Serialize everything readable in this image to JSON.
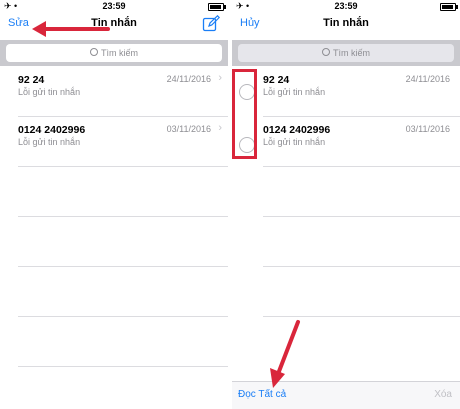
{
  "status_bar": {
    "time": "23:59",
    "left_icons": "✈ •"
  },
  "left_screen": {
    "nav": {
      "edit_label": "Sửa",
      "title": "Tin nhắn"
    },
    "search": {
      "placeholder": "Tìm kiếm"
    },
    "conversations": [
      {
        "name": "92 24",
        "date": "24/11/2016",
        "subtitle": "Lỗi gửi tin nhắn"
      },
      {
        "name": "0124 2402996",
        "date": "03/11/2016",
        "subtitle": "Lỗi gửi tin nhắn"
      }
    ]
  },
  "right_screen": {
    "nav": {
      "cancel_label": "Hủy",
      "title": "Tin nhắn"
    },
    "search": {
      "placeholder": "Tìm kiếm"
    },
    "conversations": [
      {
        "name": "92 24",
        "date": "24/11/2016",
        "subtitle": "Lỗi gửi tin nhắn"
      },
      {
        "name": "0124 2402996",
        "date": "03/11/2016",
        "subtitle": "Lỗi gửi tin nhắn"
      }
    ],
    "toolbar": {
      "read_all_label": "Đọc Tất cả",
      "delete_label": "Xóa"
    }
  },
  "colors": {
    "accent": "#1a7ef6",
    "annotation": "#d9263b",
    "secondary_text": "#8e8e93"
  },
  "icons": {
    "compose": "compose-icon",
    "search": "search-icon",
    "chevron": "chevron-right-icon",
    "select": "radio-circle-icon"
  }
}
